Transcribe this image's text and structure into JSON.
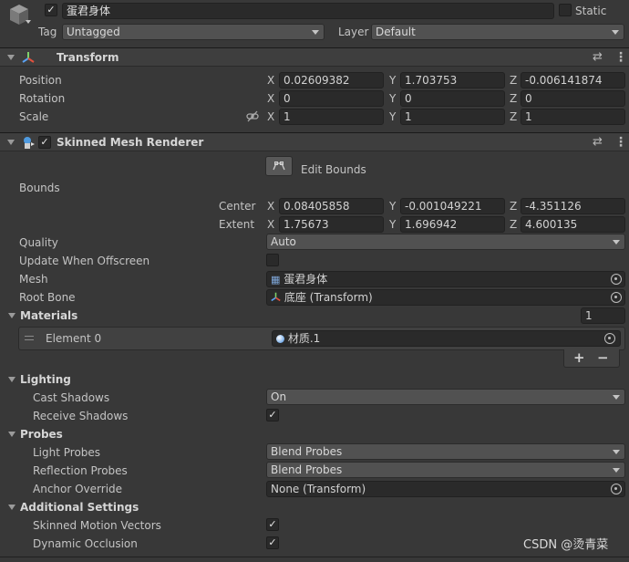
{
  "object": {
    "name": "蛋君身体",
    "enabled_check": "✓",
    "static_label": "Static",
    "tag_label": "Tag",
    "tag_value": "Untagged",
    "layer_label": "Layer",
    "layer_value": "Default"
  },
  "transform": {
    "title": "Transform",
    "position_label": "Position",
    "rotation_label": "Rotation",
    "scale_label": "Scale",
    "x": "X",
    "y": "Y",
    "z": "Z",
    "position": [
      "0.02609382",
      "1.703753",
      "-0.006141874"
    ],
    "rotation": [
      "0",
      "0",
      "0"
    ],
    "scale": [
      "1",
      "1",
      "1"
    ]
  },
  "smr": {
    "title": "Skinned Mesh Renderer",
    "enabled_check": "✓",
    "edit_bounds_label": "Edit Bounds",
    "bounds_label": "Bounds",
    "center_label": "Center",
    "extent_label": "Extent",
    "center": [
      "0.08405858",
      "-0.001049221",
      "-4.351126"
    ],
    "extent": [
      "1.75673",
      "1.696942",
      "4.600135"
    ],
    "quality_label": "Quality",
    "quality_value": "Auto",
    "update_offscreen_label": "Update When Offscreen",
    "mesh_label": "Mesh",
    "mesh_value": "蛋君身体",
    "root_bone_label": "Root Bone",
    "root_bone_value": "底座 (Transform)",
    "materials_label": "Materials",
    "materials_count": "1",
    "element0_label": "Element 0",
    "element0_value": "材质.1",
    "add_label": "+",
    "remove_label": "−",
    "lighting_label": "Lighting",
    "cast_shadows_label": "Cast Shadows",
    "cast_shadows_value": "On",
    "receive_shadows_label": "Receive Shadows",
    "receive_shadows_check": "✓",
    "probes_label": "Probes",
    "light_probes_label": "Light Probes",
    "light_probes_value": "Blend Probes",
    "reflection_probes_label": "Reflection Probes",
    "reflection_probes_value": "Blend Probes",
    "anchor_override_label": "Anchor Override",
    "anchor_override_value": "None (Transform)",
    "additional_label": "Additional Settings",
    "skinned_motion_label": "Skinned Motion Vectors",
    "skinned_motion_check": "✓",
    "dynamic_occlusion_label": "Dynamic Occlusion",
    "dynamic_occlusion_check": "✓"
  },
  "watermark": "CSDN @烫青菜"
}
